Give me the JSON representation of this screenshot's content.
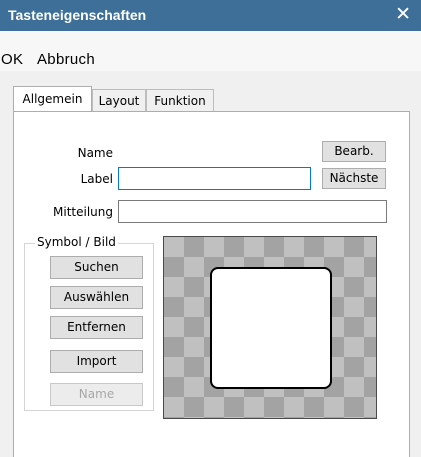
{
  "window": {
    "title": "Tasteneigenschaften",
    "close_glyph": "✕"
  },
  "menu": {
    "ok": "OK",
    "abbruch": "Abbruch"
  },
  "tabs": [
    "Allgemein",
    "Layout",
    "Funktion"
  ],
  "form": {
    "name_label": "Name",
    "label_label": "Label",
    "label_value": "",
    "mitteilung_label": "Mitteilung",
    "mitteilung_value": "",
    "edit_button": "Bearb.",
    "next_button": "Nächste"
  },
  "symbol_group": {
    "title": "Symbol / Bild",
    "buttons": [
      "Suchen",
      "Auswählen",
      "Entfernen",
      "Import",
      "Name"
    ]
  },
  "colors": {
    "titlebar": "#3d6f99",
    "focus_border": "#0078d7",
    "disabled_text": "#a8a8a8"
  }
}
